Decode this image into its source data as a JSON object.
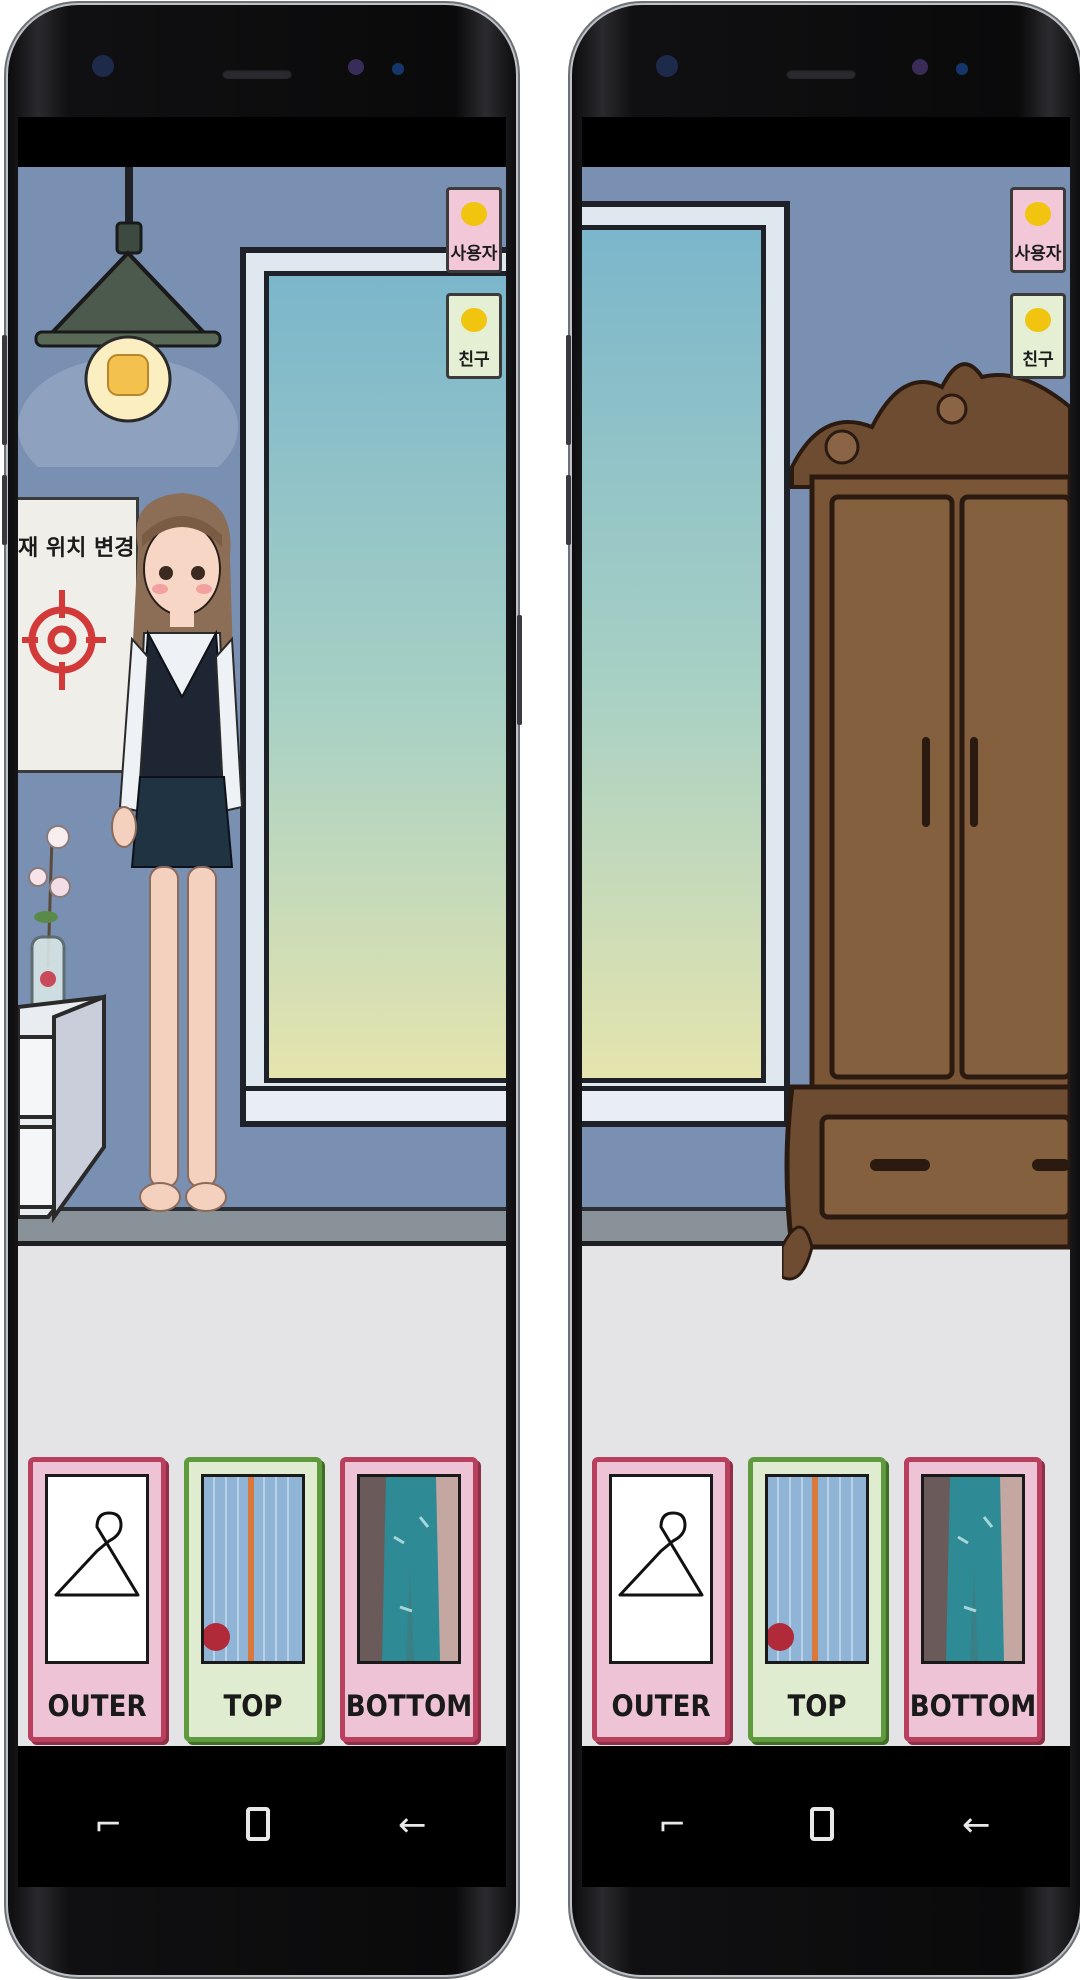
{
  "phones": [
    {
      "side_tabs": [
        {
          "label": "사용자",
          "color": "#f2c7d8",
          "icon": "smiley-face-icon"
        },
        {
          "label": "친구",
          "color": "#e4efd4",
          "icon": "friends-heart-icon"
        }
      ],
      "poster_text": "재 위치 변경",
      "closet": [
        {
          "label": "OUTER",
          "icon": "hanger-icon"
        },
        {
          "label": "TOP",
          "icon": "shirt-photo"
        },
        {
          "label": "BOTTOM",
          "icon": "jeans-photo"
        }
      ],
      "nav": {
        "recent": "recent-apps-icon",
        "home": "home-icon",
        "back": "back-icon"
      }
    },
    {
      "side_tabs": [
        {
          "label": "사용자",
          "color": "#f2c7d8",
          "icon": "smiley-face-icon"
        },
        {
          "label": "친구",
          "color": "#e4efd4",
          "icon": "friends-heart-icon"
        }
      ],
      "closet": [
        {
          "label": "OUTER",
          "icon": "hanger-icon"
        },
        {
          "label": "TOP",
          "icon": "shirt-photo"
        },
        {
          "label": "BOTTOM",
          "icon": "jeans-photo"
        }
      ],
      "nav": {
        "recent": "recent-apps-icon",
        "home": "home-icon",
        "back": "back-icon"
      }
    }
  ],
  "colors": {
    "wall": "#7a90b3",
    "floor": "#e4e3e6",
    "outer_card": "#efc3d6",
    "top_card": "#e0eccf",
    "bottom_card": "#efc3d6",
    "wardrobe": "#7a5536"
  }
}
